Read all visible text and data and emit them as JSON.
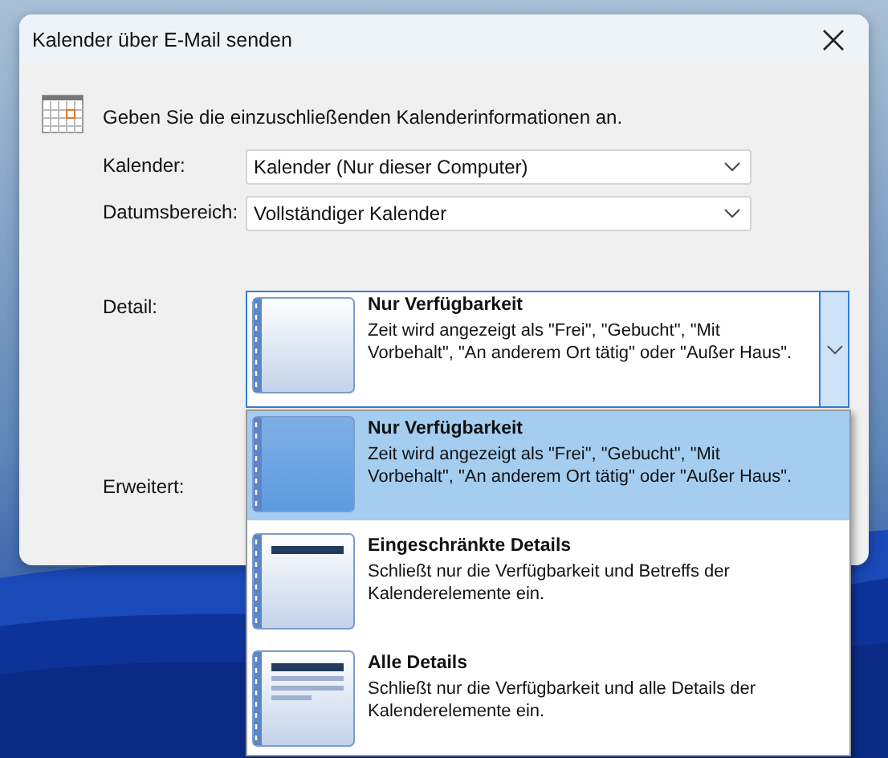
{
  "window": {
    "title": "Kalender über E-Mail senden"
  },
  "intro": "Geben Sie die einzuschließenden Kalenderinformationen an.",
  "fields": [
    {
      "label": "Kalender:",
      "value": "Kalender (Nur dieser Computer)"
    },
    {
      "label": "Datumsbereich:",
      "value": "Vollständiger Kalender"
    }
  ],
  "detail": {
    "label": "Detail:",
    "title": "Nur Verfügbarkeit",
    "description": "Zeit wird angezeigt als \"Frei\", \"Gebucht\", \"Mit Vorbehalt\", \"An anderem Ort tätig\" oder \"Außer Haus\"."
  },
  "advanced": {
    "label": "Erweitert:"
  },
  "detail_options": [
    {
      "kind": "none",
      "title": "Nur Verfügbarkeit",
      "description": "Zeit wird angezeigt als \"Frei\", \"Gebucht\", \"Mit Vorbehalt\", \"An anderem Ort tätig\" oder \"Außer Haus\".",
      "selected": true
    },
    {
      "kind": "subjects",
      "title": "Eingeschränkte Details",
      "description": "Schließt nur die Verfügbarkeit und Betreffs der Kalenderelemente ein.",
      "selected": false
    },
    {
      "kind": "full",
      "title": "Alle Details",
      "description": "Schließt nur die Verfügbarkeit und alle Details der Kalenderelemente ein.",
      "selected": false
    }
  ]
}
